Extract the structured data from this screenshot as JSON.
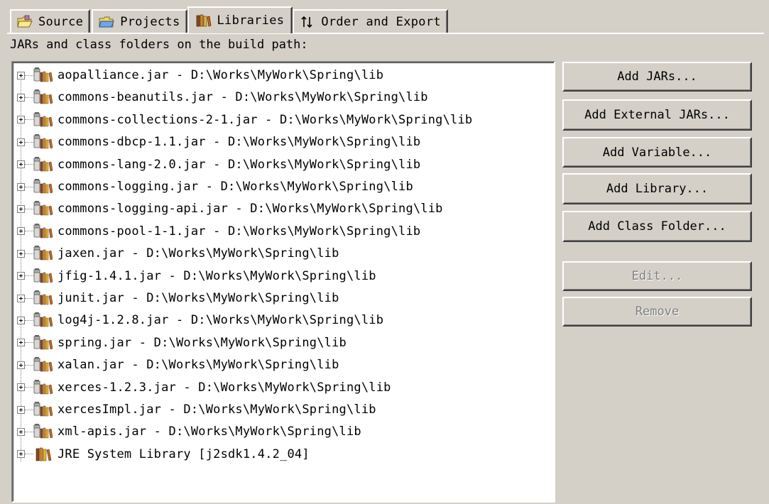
{
  "tabs": [
    {
      "label": "Source",
      "icon": "source-folder-icon",
      "active": false
    },
    {
      "label": "Projects",
      "icon": "projects-folder-icon",
      "active": false
    },
    {
      "label": "Libraries",
      "icon": "libraries-icon",
      "active": true
    },
    {
      "label": "Order and Export",
      "icon": "order-arrows-icon",
      "active": false
    }
  ],
  "heading": "JARs and class folders on the build path:",
  "entries": [
    {
      "text": "aopalliance.jar - D:\\Works\\MyWork\\Spring\\lib",
      "icon": "jar-icon"
    },
    {
      "text": "commons-beanutils.jar - D:\\Works\\MyWork\\Spring\\lib",
      "icon": "jar-icon"
    },
    {
      "text": "commons-collections-2-1.jar - D:\\Works\\MyWork\\Spring\\lib",
      "icon": "jar-icon"
    },
    {
      "text": "commons-dbcp-1.1.jar - D:\\Works\\MyWork\\Spring\\lib",
      "icon": "jar-icon"
    },
    {
      "text": "commons-lang-2.0.jar - D:\\Works\\MyWork\\Spring\\lib",
      "icon": "jar-icon"
    },
    {
      "text": "commons-logging.jar - D:\\Works\\MyWork\\Spring\\lib",
      "icon": "jar-icon"
    },
    {
      "text": "commons-logging-api.jar - D:\\Works\\MyWork\\Spring\\lib",
      "icon": "jar-icon"
    },
    {
      "text": "commons-pool-1-1.jar - D:\\Works\\MyWork\\Spring\\lib",
      "icon": "jar-icon"
    },
    {
      "text": "jaxen.jar - D:\\Works\\MyWork\\Spring\\lib",
      "icon": "jar-icon"
    },
    {
      "text": "jfig-1.4.1.jar - D:\\Works\\MyWork\\Spring\\lib",
      "icon": "jar-icon"
    },
    {
      "text": "junit.jar - D:\\Works\\MyWork\\Spring\\lib",
      "icon": "jar-icon"
    },
    {
      "text": "log4j-1.2.8.jar - D:\\Works\\MyWork\\Spring\\lib",
      "icon": "jar-icon"
    },
    {
      "text": "spring.jar - D:\\Works\\MyWork\\Spring\\lib",
      "icon": "jar-icon"
    },
    {
      "text": "xalan.jar - D:\\Works\\MyWork\\Spring\\lib",
      "icon": "jar-icon"
    },
    {
      "text": "xerces-1.2.3.jar - D:\\Works\\MyWork\\Spring\\lib",
      "icon": "jar-icon"
    },
    {
      "text": "xercesImpl.jar - D:\\Works\\MyWork\\Spring\\lib",
      "icon": "jar-icon"
    },
    {
      "text": "xml-apis.jar - D:\\Works\\MyWork\\Spring\\lib",
      "icon": "jar-icon"
    },
    {
      "text": "JRE System Library [j2sdk1.4.2_04]",
      "icon": "library-books-icon"
    }
  ],
  "buttons": [
    {
      "label": "Add JARs...",
      "enabled": true
    },
    {
      "label": "Add External JARs...",
      "enabled": true
    },
    {
      "label": "Add Variable...",
      "enabled": true
    },
    {
      "label": "Add Library...",
      "enabled": true
    },
    {
      "label": "Add Class Folder...",
      "enabled": true
    },
    {
      "label": "Edit...",
      "enabled": false
    },
    {
      "label": "Remove",
      "enabled": false
    }
  ],
  "colors": {
    "dialog_bg": "#d4d0c8",
    "tree_bg": "#ffffff",
    "disabled_text": "#808080"
  }
}
